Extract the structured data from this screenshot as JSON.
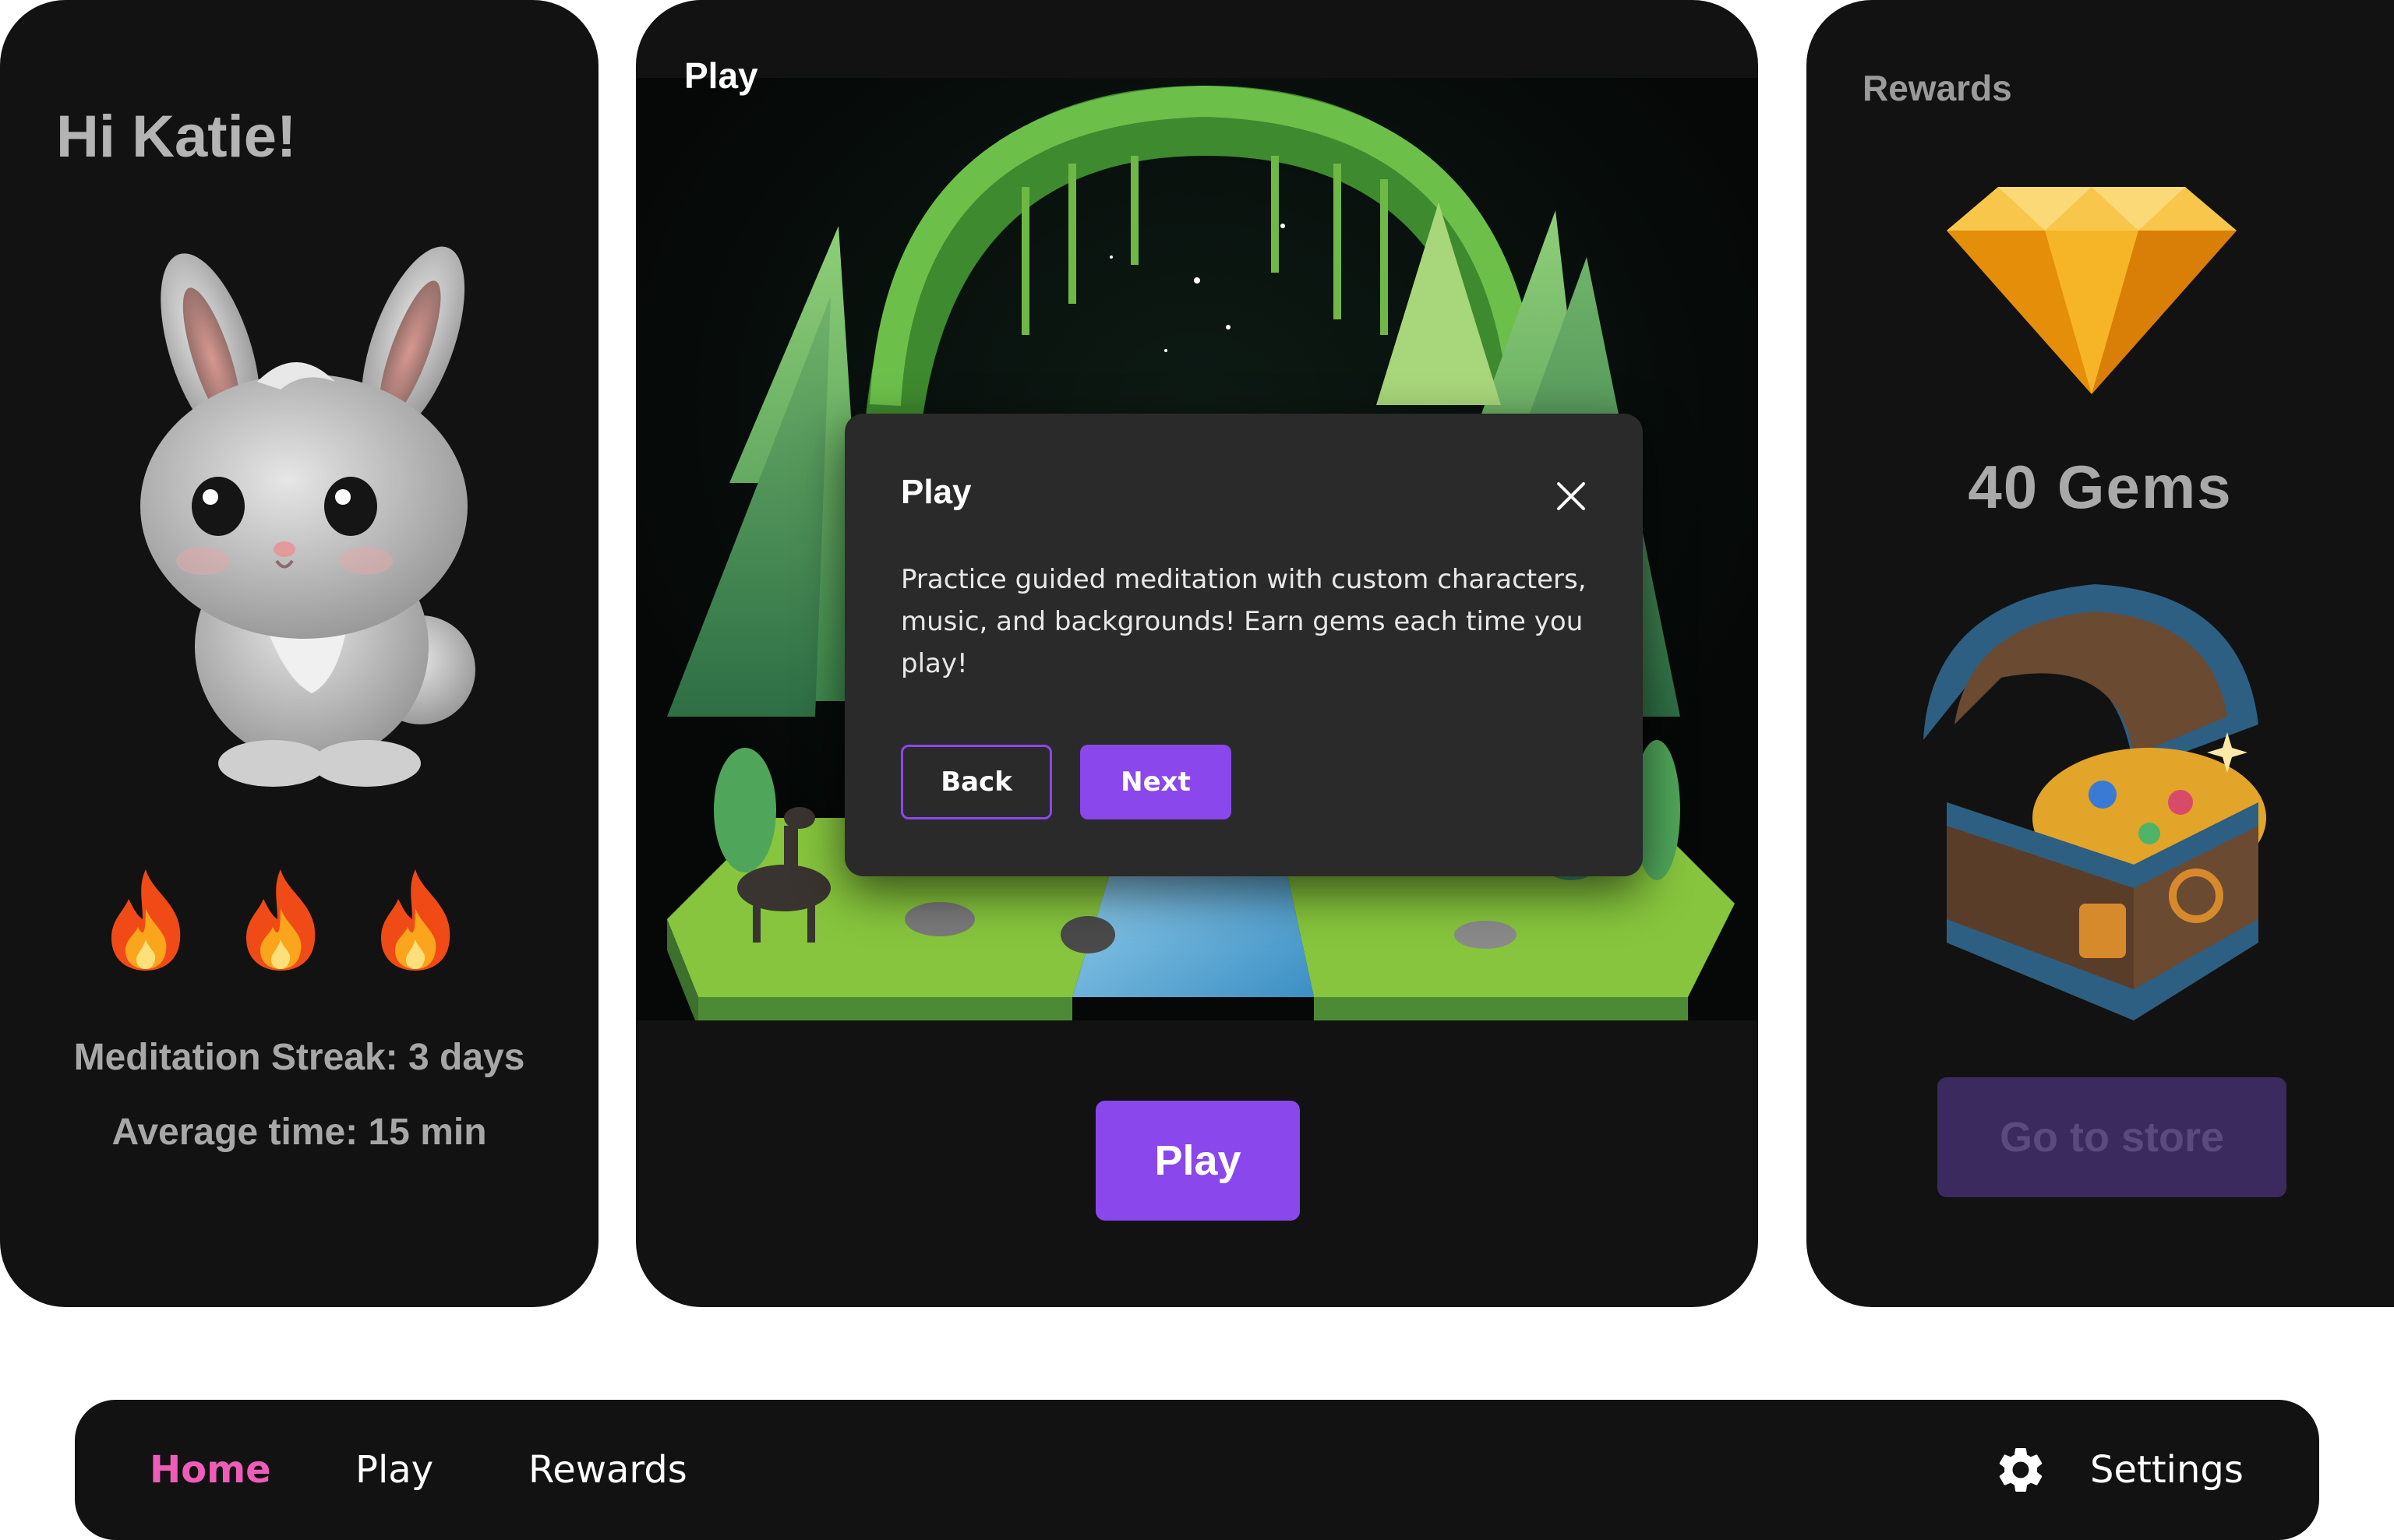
{
  "home_card": {
    "greeting": "Hi Katie!",
    "streak_text": "Meditation Streak: 3 days",
    "average_text": "Average time: 15 min",
    "streak_flames": 3
  },
  "play_card": {
    "title": "Play",
    "play_button": "Play",
    "dialog": {
      "title": "Play",
      "body": "Practice guided meditation with custom characters, music, and backgrounds! Earn gems each time you play!",
      "back_label": "Back",
      "next_label": "Next"
    }
  },
  "rewards_card": {
    "title": "Rewards",
    "gem_count": "40 Gems",
    "store_button": "Go to store"
  },
  "nav": {
    "home": "Home",
    "play": "Play",
    "rewards": "Rewards",
    "settings": "Settings"
  },
  "colors": {
    "card_bg": "#121212",
    "accent_purple": "#8a47ec",
    "active_nav_pink": "#ef5cb8",
    "dialog_bg": "#2a2a2a",
    "store_button_bg": "#3a2a5e"
  },
  "icons": {
    "close": "close-icon",
    "settings": "gear-icon",
    "streak": "flame-icon",
    "gem": "gem-icon",
    "chest": "treasure-chest-icon",
    "character": "bunny-icon"
  }
}
